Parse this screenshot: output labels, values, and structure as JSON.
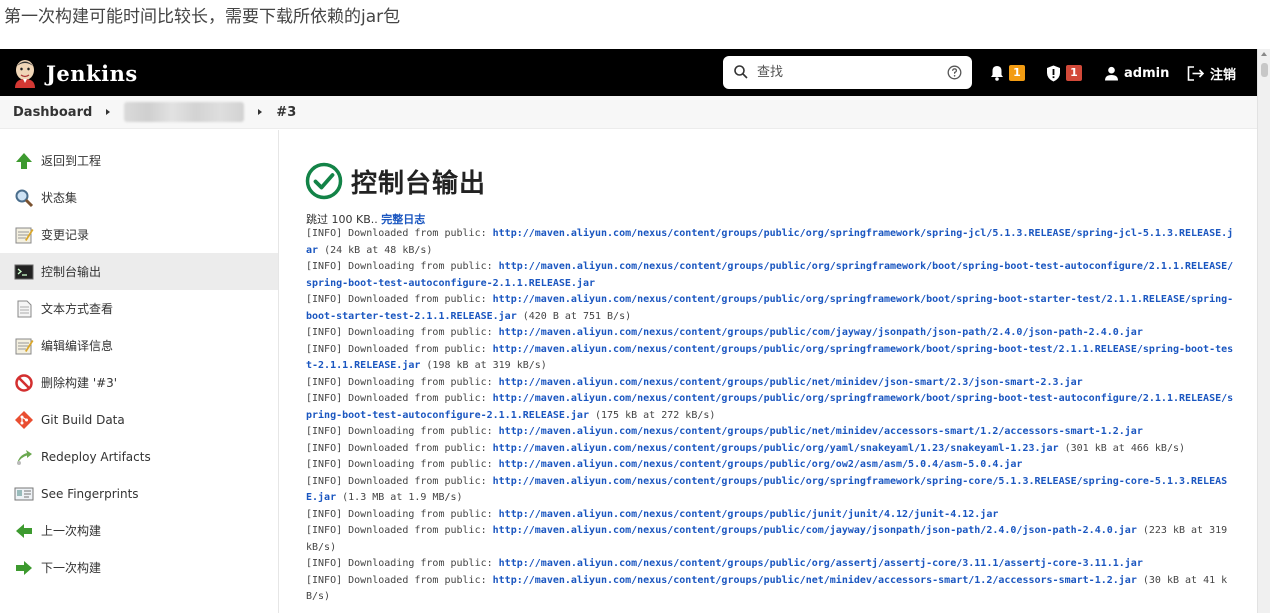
{
  "caption": "第一次构建可能时间比较长，需要下载所依赖的jar包",
  "header": {
    "brand": "Jenkins",
    "search_placeholder": "查找",
    "notifications_count": "1",
    "security_count": "1",
    "user": "admin",
    "logout": "注销"
  },
  "breadcrumb": {
    "dashboard": "Dashboard",
    "build": "#3"
  },
  "sidebar": {
    "items": [
      {
        "label": "返回到工程",
        "icon": "up-arrow-icon"
      },
      {
        "label": "状态集",
        "icon": "magnifier-icon"
      },
      {
        "label": "变更记录",
        "icon": "notepad-icon"
      },
      {
        "label": "控制台输出",
        "icon": "terminal-icon",
        "active": true
      },
      {
        "label": "文本方式查看",
        "icon": "document-icon"
      },
      {
        "label": "编辑编译信息",
        "icon": "notepad-icon"
      },
      {
        "label": "删除构建 '#3'",
        "icon": "no-entry-icon"
      },
      {
        "label": "Git Build Data",
        "icon": "git-icon"
      },
      {
        "label": "Redeploy Artifacts",
        "icon": "redeploy-icon"
      },
      {
        "label": "See Fingerprints",
        "icon": "fingerprint-icon"
      },
      {
        "label": "上一次构建",
        "icon": "left-arrow-icon"
      },
      {
        "label": "下一次构建",
        "icon": "right-arrow-icon"
      }
    ]
  },
  "main": {
    "title": "控制台输出",
    "skip_prefix": "跳过 100 KB.. ",
    "full_log": "完整日志",
    "console": [
      {
        "p": "[INFO] Downloaded from public: ",
        "url": "http://maven.aliyun.com/nexus/content/groups/public/org/springframework/spring-jcl/5.1.3.RELEASE/spring-jcl-5.1.3.RELEASE.jar",
        "s": " (24 kB at 48 kB/s)"
      },
      {
        "p": "[INFO] Downloading from public: ",
        "url": "http://maven.aliyun.com/nexus/content/groups/public/org/springframework/boot/spring-boot-test-autoconfigure/2.1.1.RELEASE/spring-boot-test-autoconfigure-2.1.1.RELEASE.jar",
        "s": ""
      },
      {
        "p": "[INFO] Downloaded from public: ",
        "url": "http://maven.aliyun.com/nexus/content/groups/public/org/springframework/boot/spring-boot-starter-test/2.1.1.RELEASE/spring-boot-starter-test-2.1.1.RELEASE.jar",
        "s": " (420 B at 751 B/s)"
      },
      {
        "p": "[INFO] Downloading from public: ",
        "url": "http://maven.aliyun.com/nexus/content/groups/public/com/jayway/jsonpath/json-path/2.4.0/json-path-2.4.0.jar",
        "s": ""
      },
      {
        "p": "[INFO] Downloaded from public: ",
        "url": "http://maven.aliyun.com/nexus/content/groups/public/org/springframework/boot/spring-boot-test/2.1.1.RELEASE/spring-boot-test-2.1.1.RELEASE.jar",
        "s": " (198 kB at 319 kB/s)"
      },
      {
        "p": "[INFO] Downloading from public: ",
        "url": "http://maven.aliyun.com/nexus/content/groups/public/net/minidev/json-smart/2.3/json-smart-2.3.jar",
        "s": ""
      },
      {
        "p": "[INFO] Downloaded from public: ",
        "url": "http://maven.aliyun.com/nexus/content/groups/public/org/springframework/boot/spring-boot-test-autoconfigure/2.1.1.RELEASE/spring-boot-test-autoconfigure-2.1.1.RELEASE.jar",
        "s": " (175 kB at 272 kB/s)"
      },
      {
        "p": "[INFO] Downloading from public: ",
        "url": "http://maven.aliyun.com/nexus/content/groups/public/net/minidev/accessors-smart/1.2/accessors-smart-1.2.jar",
        "s": ""
      },
      {
        "p": "[INFO] Downloaded from public: ",
        "url": "http://maven.aliyun.com/nexus/content/groups/public/org/yaml/snakeyaml/1.23/snakeyaml-1.23.jar",
        "s": " (301 kB at 466 kB/s)"
      },
      {
        "p": "[INFO] Downloading from public: ",
        "url": "http://maven.aliyun.com/nexus/content/groups/public/org/ow2/asm/asm/5.0.4/asm-5.0.4.jar",
        "s": ""
      },
      {
        "p": "[INFO] Downloaded from public: ",
        "url": "http://maven.aliyun.com/nexus/content/groups/public/org/springframework/spring-core/5.1.3.RELEASE/spring-core-5.1.3.RELEASE.jar",
        "s": " (1.3 MB at 1.9 MB/s)"
      },
      {
        "p": "[INFO] Downloading from public: ",
        "url": "http://maven.aliyun.com/nexus/content/groups/public/junit/junit/4.12/junit-4.12.jar",
        "s": ""
      },
      {
        "p": "[INFO] Downloaded from public: ",
        "url": "http://maven.aliyun.com/nexus/content/groups/public/com/jayway/jsonpath/json-path/2.4.0/json-path-2.4.0.jar",
        "s": " (223 kB at 319 kB/s)"
      },
      {
        "p": "[INFO] Downloading from public: ",
        "url": "http://maven.aliyun.com/nexus/content/groups/public/org/assertj/assertj-core/3.11.1/assertj-core-3.11.1.jar",
        "s": ""
      },
      {
        "p": "[INFO] Downloaded from public: ",
        "url": "http://maven.aliyun.com/nexus/content/groups/public/net/minidev/accessors-smart/1.2/accessors-smart-1.2.jar",
        "s": " (30 kB at 41 kB/s)"
      }
    ]
  },
  "colors": {
    "header_bg": "#000000",
    "link": "#1a56c0",
    "success": "#138347",
    "badge_orange": "#f39c12",
    "badge_red": "#d24939"
  }
}
